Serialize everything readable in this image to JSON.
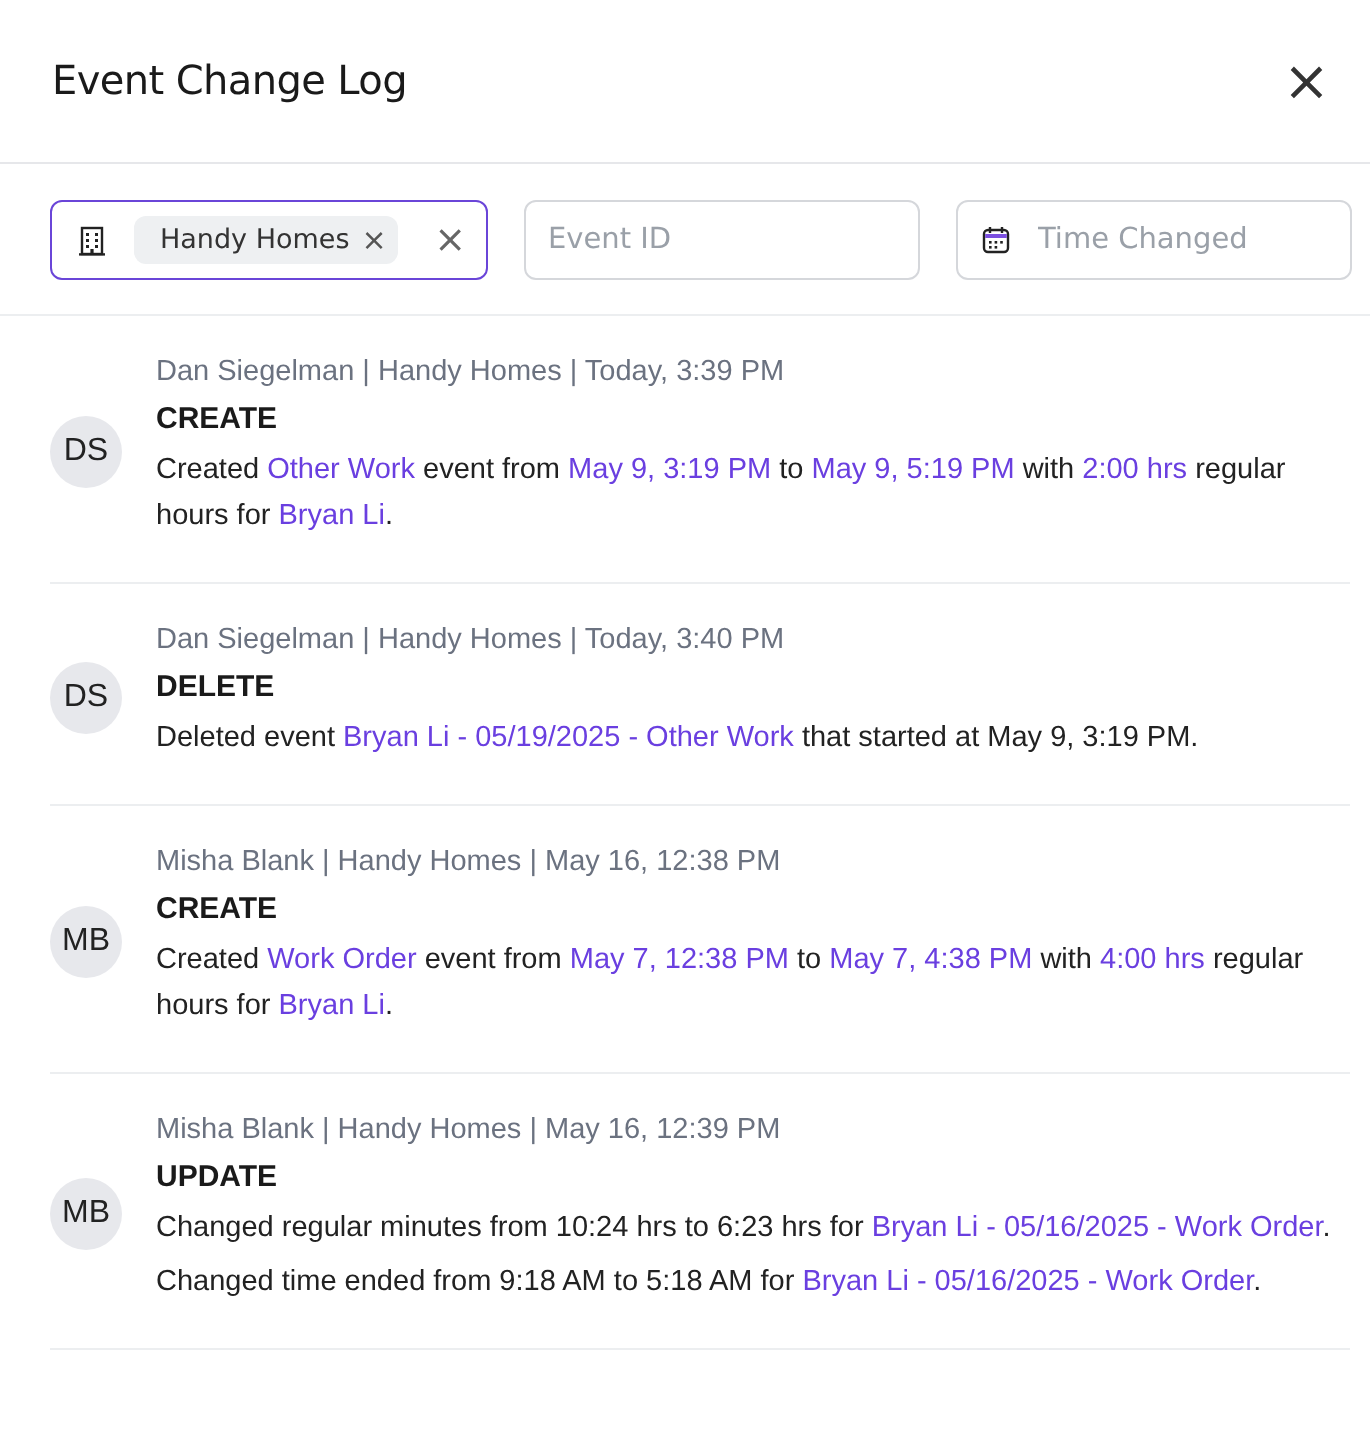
{
  "dialog": {
    "title": "Event Change Log",
    "close_icon": "×"
  },
  "filters": {
    "company": {
      "chip": "Handy Homes",
      "chip_remove": "×",
      "clear": "×"
    },
    "event_id": {
      "placeholder": "Event ID"
    },
    "time_changed": {
      "placeholder": "Time Changed"
    }
  },
  "entries": [
    {
      "initials": "DS",
      "meta": "Dan Siegelman | Handy Homes | Today, 3:39 PM",
      "action": "CREATE",
      "lines": [
        [
          {
            "kind": "text",
            "text": "Created "
          },
          {
            "kind": "link",
            "text": "Other Work"
          },
          {
            "kind": "text",
            "text": " event from "
          },
          {
            "kind": "link",
            "text": "May 9, 3:19 PM"
          },
          {
            "kind": "text",
            "text": " to "
          },
          {
            "kind": "link",
            "text": "May 9, 5:19 PM"
          },
          {
            "kind": "text",
            "text": " with "
          },
          {
            "kind": "link",
            "text": "2:00 hrs"
          },
          {
            "kind": "text",
            "text": " regular hours for "
          },
          {
            "kind": "link",
            "text": "Bryan Li"
          },
          {
            "kind": "text",
            "text": "."
          }
        ]
      ]
    },
    {
      "initials": "DS",
      "meta": "Dan Siegelman | Handy Homes | Today, 3:40 PM",
      "action": "DELETE",
      "lines": [
        [
          {
            "kind": "text",
            "text": "Deleted event "
          },
          {
            "kind": "link",
            "text": "Bryan Li - 05/19/2025 - Other Work"
          },
          {
            "kind": "text",
            "text": " that started at May 9, 3:19 PM."
          }
        ]
      ]
    },
    {
      "initials": "MB",
      "meta": "Misha Blank | Handy Homes | May 16, 12:38 PM",
      "action": "CREATE",
      "lines": [
        [
          {
            "kind": "text",
            "text": "Created "
          },
          {
            "kind": "link",
            "text": "Work Order"
          },
          {
            "kind": "text",
            "text": " event from "
          },
          {
            "kind": "link",
            "text": "May 7, 12:38 PM"
          },
          {
            "kind": "text",
            "text": " to "
          },
          {
            "kind": "link",
            "text": "May 7, 4:38 PM"
          },
          {
            "kind": "text",
            "text": " with "
          },
          {
            "kind": "link",
            "text": "4:00 hrs"
          },
          {
            "kind": "text",
            "text": " regular hours for "
          },
          {
            "kind": "link",
            "text": "Bryan Li"
          },
          {
            "kind": "text",
            "text": "."
          }
        ]
      ]
    },
    {
      "initials": "MB",
      "meta": "Misha Blank | Handy Homes | May 16, 12:39 PM",
      "action": "UPDATE",
      "lines": [
        [
          {
            "kind": "text",
            "text": "Changed regular minutes from 10:24 hrs to 6:23 hrs for "
          },
          {
            "kind": "link",
            "text": "Bryan Li - 05/16/2025 - Work Order"
          },
          {
            "kind": "text",
            "text": "."
          }
        ],
        [
          {
            "kind": "text",
            "text": "Changed time ended from 9:18 AM to 5:18 AM for "
          },
          {
            "kind": "link",
            "text": "Bryan Li - 05/16/2025 - Work Order"
          },
          {
            "kind": "text",
            "text": "."
          }
        ]
      ]
    }
  ]
}
